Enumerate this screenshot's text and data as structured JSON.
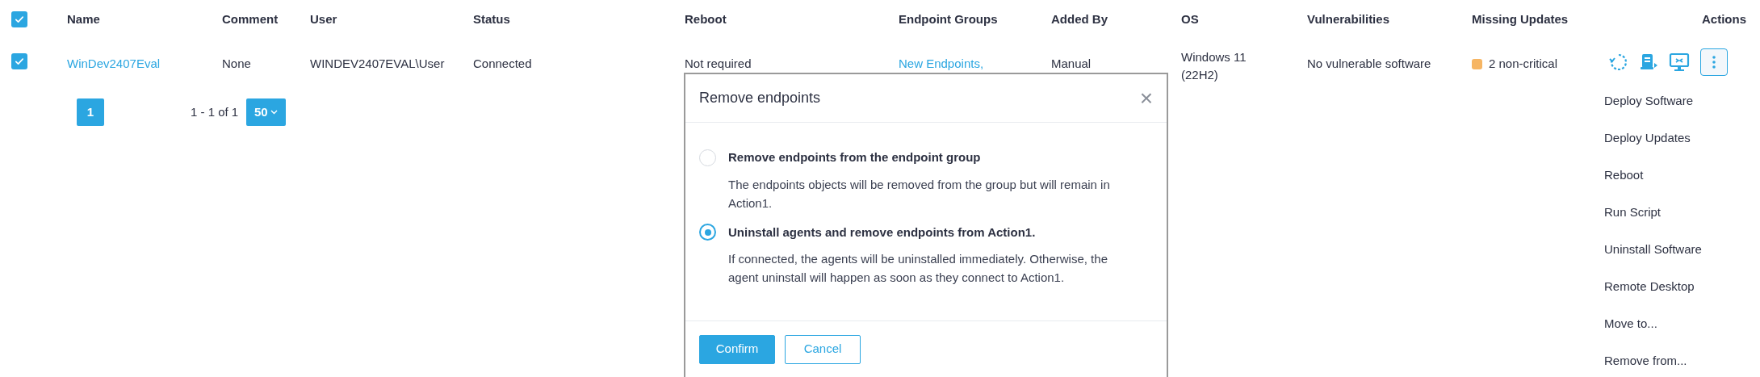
{
  "header_checkbox": {
    "checked": true
  },
  "columns": [
    "Name",
    "Comment",
    "User",
    "Status",
    "Reboot",
    "Endpoint Groups",
    "Added By",
    "OS",
    "Vulnerabilities",
    "Missing Updates",
    "Actions"
  ],
  "rows": [
    {
      "selected": true,
      "name": "WinDev2407Eval",
      "comment": "None",
      "user": "WINDEV2407EVAL\\User",
      "status": "Connected",
      "reboot": "Not required",
      "endpoint_groups": "New Endpoints,",
      "added_by": "Manual",
      "os": "Windows 11 (22H2)",
      "vulnerabilities": "No vulnerable software",
      "missing_updates": {
        "text": "2 non-critical",
        "color": "#f6b563"
      }
    }
  ],
  "pagination": {
    "pages": [
      {
        "label": "1",
        "selected": true
      }
    ],
    "range": "1 - 1 of 1",
    "page_size": "50"
  },
  "actions_menu": {
    "items": [
      "Deploy Software",
      "Deploy Updates",
      "Reboot",
      "Run Script",
      "Uninstall Software",
      "Remote Desktop",
      "Move to...",
      "Remove from..."
    ]
  },
  "dialog": {
    "title": "Remove endpoints",
    "close": "×",
    "options": [
      {
        "label": "Remove endpoints from the endpoint group",
        "description": "The endpoints objects will be removed from the group but will remain in Action1.",
        "selected": false
      },
      {
        "label": "Uninstall agents and remove endpoints from Action1.",
        "description": "If connected, the agents will be uninstalled immediately. Otherwise, the agent uninstall will happen as soon as they connect to Action1.",
        "selected": true
      }
    ],
    "buttons": [
      {
        "label": "Confirm",
        "kind": "primary"
      },
      {
        "label": "Cancel",
        "kind": "secondary"
      }
    ]
  }
}
